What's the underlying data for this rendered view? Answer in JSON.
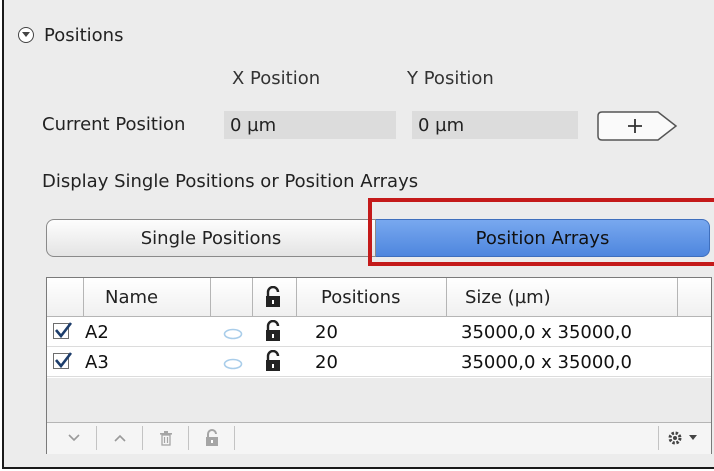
{
  "section": {
    "title": "Positions",
    "icon": "collapse-circle-icon"
  },
  "columns": {
    "x_label": "X Position",
    "y_label": "Y Position"
  },
  "current_position": {
    "label": "Current Position",
    "x_value": "0 µm",
    "y_value": "0 µm",
    "add_button": "+"
  },
  "display": {
    "label": "Display Single Positions or Position Arrays",
    "options": [
      "Single Positions",
      "Position Arrays"
    ],
    "selected": "Position Arrays"
  },
  "table": {
    "headers": [
      "Name",
      "Positions",
      "Size (µm)"
    ],
    "rows": [
      {
        "checked": true,
        "name": "A2",
        "positions": "20",
        "size": "35000,0 x 35000,0"
      },
      {
        "checked": true,
        "name": "A3",
        "positions": "20",
        "size": "35000,0 x 35000,0"
      }
    ]
  },
  "colors": {
    "accent": "#5b90e6",
    "highlight": "#c41a1a",
    "panel": "#ececec"
  }
}
